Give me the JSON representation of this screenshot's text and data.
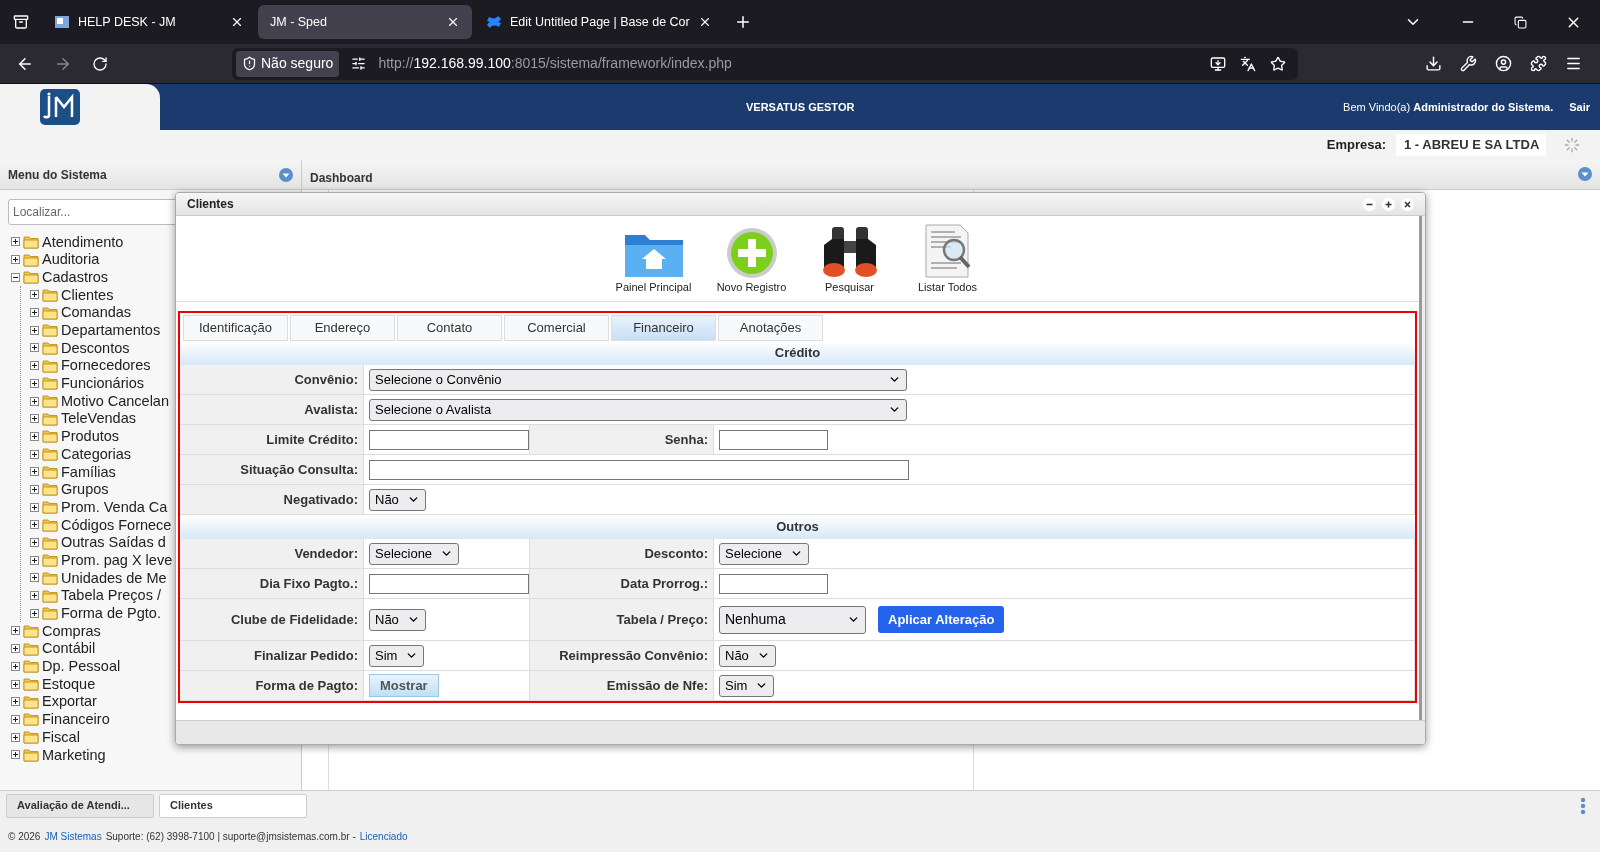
{
  "browser": {
    "tabs": [
      {
        "title": "HELP DESK - JM",
        "selected": false,
        "kind": "helpdesk"
      },
      {
        "title": "JM - Sped",
        "selected": true,
        "kind": "plain"
      },
      {
        "title": "Edit Untitled Page | Base de Cor",
        "selected": false,
        "kind": "confluence"
      }
    ],
    "security": "Não seguro",
    "url_scheme": "http://",
    "url_host": "192.168.99.100",
    "url_path": ":8015/sistema/framework/index.php"
  },
  "header": {
    "title": "VERSATUS GESTOR",
    "welcome": "Bem Vindo(a)",
    "user": "Administrador do Sistema.",
    "logout": "Sair",
    "company_label": "Empresa:",
    "company": "1 - ABREU E SA LTDA"
  },
  "sidebar": {
    "title": "Menu do Sistema",
    "search_placeholder": "Localizar...",
    "tree": [
      {
        "label": "Atendimento",
        "expanded": false
      },
      {
        "label": "Auditoria",
        "expanded": false
      },
      {
        "label": "Cadastros",
        "expanded": true,
        "children": [
          {
            "label": "Clientes",
            "expanded": false
          },
          {
            "label": "Comandas",
            "expanded": false
          },
          {
            "label": "Departamentos",
            "expanded": false
          },
          {
            "label": "Descontos",
            "expanded": false
          },
          {
            "label": "Fornecedores",
            "expanded": false
          },
          {
            "label": "Funcionários",
            "expanded": false
          },
          {
            "label": "Motivo Cancelan",
            "expanded": false
          },
          {
            "label": "TeleVendas",
            "expanded": false
          },
          {
            "label": "Produtos",
            "expanded": false
          },
          {
            "label": "Categorias",
            "expanded": false
          },
          {
            "label": "Famílias",
            "expanded": false
          },
          {
            "label": "Grupos",
            "expanded": false
          },
          {
            "label": "Prom. Venda Ca",
            "expanded": false
          },
          {
            "label": "Códigos Fornece",
            "expanded": false
          },
          {
            "label": "Outras Saídas d",
            "expanded": false
          },
          {
            "label": "Prom. pag X leve",
            "expanded": false
          },
          {
            "label": "Unidades de Me",
            "expanded": false
          },
          {
            "label": "Tabela Preços /",
            "expanded": false
          },
          {
            "label": "Forma de Pgto.",
            "expanded": false
          }
        ]
      },
      {
        "label": "Compras",
        "expanded": false
      },
      {
        "label": "Contábil",
        "expanded": false
      },
      {
        "label": "Dp. Pessoal",
        "expanded": false
      },
      {
        "label": "Estoque",
        "expanded": false
      },
      {
        "label": "Exportar",
        "expanded": false
      },
      {
        "label": "Financeiro",
        "expanded": false
      },
      {
        "label": "Fiscal",
        "expanded": false
      },
      {
        "label": "Marketing",
        "expanded": false
      }
    ]
  },
  "dashboard": {
    "title": "Dashboard"
  },
  "dialog": {
    "title": "Clientes",
    "toolbar": [
      {
        "label": "Painel Principal",
        "kind": "home"
      },
      {
        "label": "Novo Registro",
        "kind": "new"
      },
      {
        "label": "Pesquisar",
        "kind": "search"
      },
      {
        "label": "Listar Todos",
        "kind": "list"
      }
    ],
    "tabs": [
      {
        "label": "Identificação",
        "selected": false
      },
      {
        "label": "Endereço",
        "selected": false
      },
      {
        "label": "Contato",
        "selected": false
      },
      {
        "label": "Comercial",
        "selected": false
      },
      {
        "label": "Financeiro",
        "selected": true
      },
      {
        "label": "Anotações",
        "selected": false
      }
    ],
    "sections": [
      {
        "title": "Crédito",
        "rows": [
          {
            "cells": [
              {
                "label": "Convênio:",
                "fields": [
                  {
                    "kind": "select",
                    "wide": true,
                    "value": "Selecione o Convênio"
                  }
                ]
              }
            ]
          },
          {
            "cells": [
              {
                "label": "Avalista:",
                "fields": [
                  {
                    "kind": "select",
                    "wide": true,
                    "value": "Selecione o Avalista"
                  }
                ]
              }
            ]
          },
          {
            "cells": [
              {
                "label": "Limite Crédito:",
                "fields": [
                  {
                    "kind": "input"
                  }
                ]
              },
              {
                "label": "Senha:",
                "fields": [
                  {
                    "kind": "input"
                  }
                ]
              }
            ]
          },
          {
            "cells": [
              {
                "label": "Situação Consulta:",
                "fields": [
                  {
                    "kind": "input",
                    "wide": true
                  }
                ]
              }
            ]
          },
          {
            "cells": [
              {
                "label": "Negativado:",
                "fields": [
                  {
                    "kind": "select",
                    "value": "Não"
                  }
                ]
              }
            ]
          }
        ]
      },
      {
        "title": "Outros",
        "rows": [
          {
            "cells": [
              {
                "label": "Vendedor:",
                "fields": [
                  {
                    "kind": "select",
                    "value": "Selecione"
                  }
                ]
              },
              {
                "label": "Desconto:",
                "fields": [
                  {
                    "kind": "select",
                    "value": "Selecione"
                  }
                ]
              }
            ]
          },
          {
            "cells": [
              {
                "label": "Dia Fixo Pagto.:",
                "fields": [
                  {
                    "kind": "input"
                  }
                ]
              },
              {
                "label": "Data Prorrog.:",
                "fields": [
                  {
                    "kind": "input"
                  }
                ]
              }
            ]
          },
          {
            "cells": [
              {
                "label": "Clube de Fidelidade:",
                "fields": [
                  {
                    "kind": "select",
                    "value": "Não"
                  }
                ]
              },
              {
                "label": "Tabela / Preço:",
                "fields": [
                  {
                    "kind": "select",
                    "value": "Nenhuma"
                  },
                  {
                    "kind": "primary",
                    "label": "Aplicar Alteração"
                  }
                ]
              }
            ]
          },
          {
            "cells": [
              {
                "label": "Finalizar Pedido:",
                "fields": [
                  {
                    "kind": "select",
                    "value": "Sim"
                  }
                ]
              },
              {
                "label": "Reimpressão Convênio:",
                "fields": [
                  {
                    "kind": "select",
                    "value": "Não"
                  }
                ]
              }
            ]
          },
          {
            "cells": [
              {
                "label": "Forma de Pagto:",
                "fields": [
                  {
                    "kind": "secondary",
                    "label": "Mostrar"
                  }
                ]
              },
              {
                "label": "Emissão de Nfe:",
                "fields": [
                  {
                    "kind": "select",
                    "value": "Sim"
                  }
                ]
              }
            ]
          }
        ]
      }
    ]
  },
  "taskbar": [
    {
      "label": "Avaliação de Atendi...",
      "selected": false
    },
    {
      "label": "Clientes",
      "selected": true
    }
  ],
  "footer": {
    "copyright": "© 2026",
    "company_link": "JM Sistemas",
    "support": "Suporte: (62) 3998-7100 | suporte@jmsistemas.com.br -",
    "license_link": "Licenciado"
  }
}
